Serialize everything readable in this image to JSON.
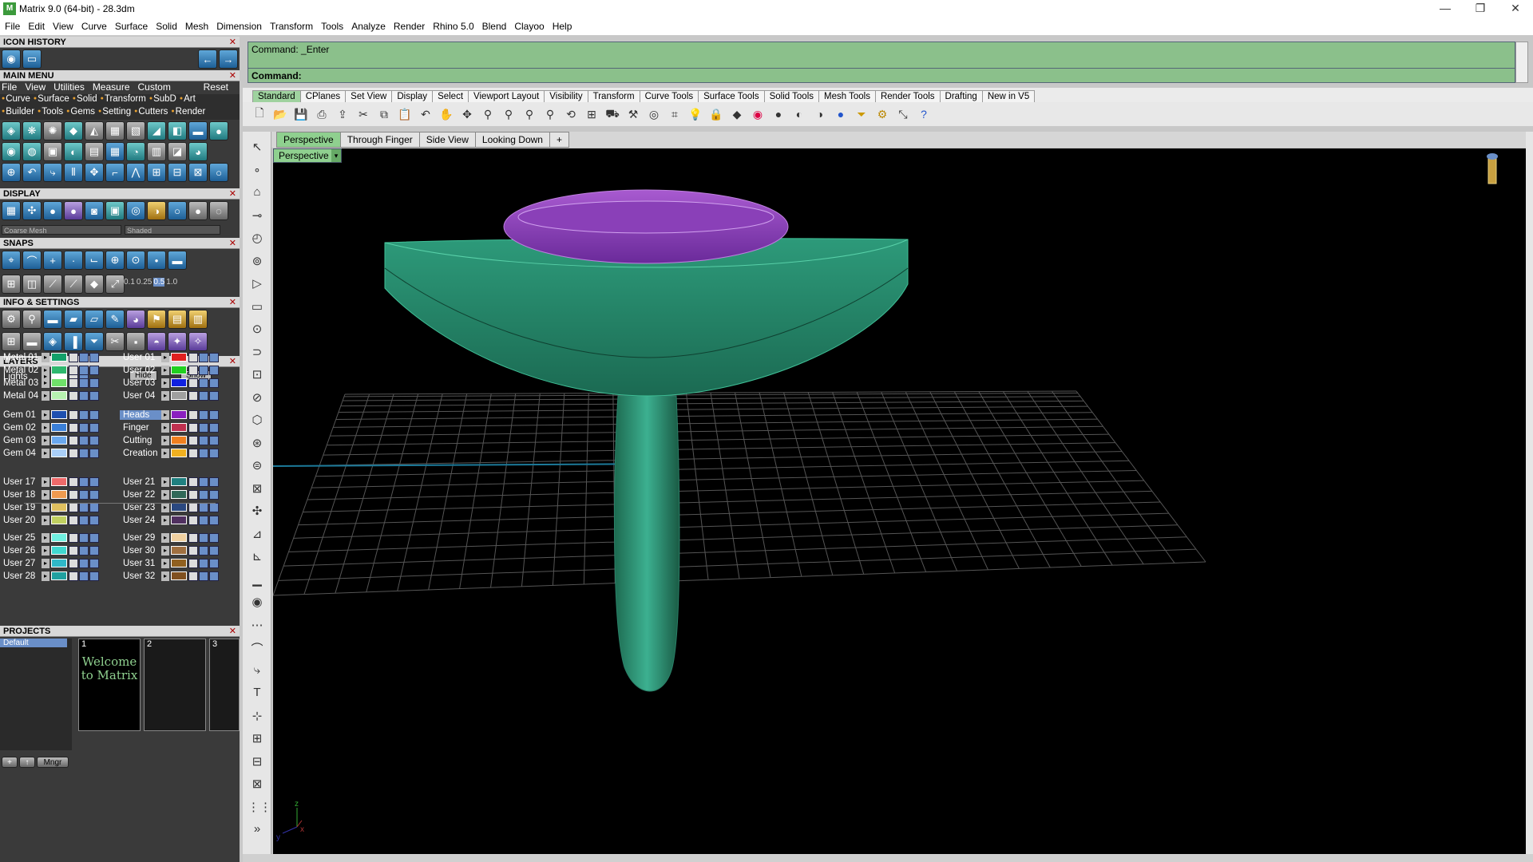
{
  "window": {
    "title": "Matrix 9.0 (64-bit) - 28.3dm",
    "minimize": "—",
    "maximize": "❐",
    "close": "✕"
  },
  "menu": [
    "File",
    "Edit",
    "View",
    "Curve",
    "Surface",
    "Solid",
    "Mesh",
    "Dimension",
    "Transform",
    "Tools",
    "Analyze",
    "Render",
    "Rhino 5.0",
    "Blend",
    "Clayoo",
    "Help"
  ],
  "left": {
    "icon_history": "ICON HISTORY",
    "main_menu": "MAIN MENU",
    "main_menu_items": [
      "File",
      "View",
      "Utilities",
      "Measure",
      "Custom"
    ],
    "reset": "Reset",
    "sub1": [
      "Curve",
      "Surface",
      "Solid",
      "Transform",
      "SubD",
      "Art"
    ],
    "sub2": [
      "Builder",
      "Tools",
      "Gems",
      "Setting",
      "Cutters",
      "Render"
    ],
    "display": "DISPLAY",
    "display_mesh": "Coarse Mesh",
    "display_mode": "Shaded",
    "snaps": "SNAPS",
    "snap_vals": [
      "0.1",
      "0.25",
      "0.5",
      "1.0"
    ],
    "info": "INFO & SETTINGS",
    "layers": "LAYERS",
    "lights": "Lights",
    "hide": "Hide",
    "show": "Show",
    "layers_left": [
      {
        "name": "Metal 01",
        "color": "#13a06a"
      },
      {
        "name": "Metal 02",
        "color": "#2eb86e"
      },
      {
        "name": "Metal 03",
        "color": "#6fe06a"
      },
      {
        "name": "Metal 04",
        "color": "#b6f0b0"
      },
      {
        "name": "Gem 01",
        "color": "#1e4fb0"
      },
      {
        "name": "Gem 02",
        "color": "#3a7fd8"
      },
      {
        "name": "Gem 03",
        "color": "#6aa8ee"
      },
      {
        "name": "Gem 04",
        "color": "#aacff8"
      },
      {
        "name": "User 17",
        "color": "#ee6a6a"
      },
      {
        "name": "User 18",
        "color": "#f09a50"
      },
      {
        "name": "User 19",
        "color": "#e0c060"
      },
      {
        "name": "User 20",
        "color": "#c0d060"
      },
      {
        "name": "User 25",
        "color": "#70f0e0"
      },
      {
        "name": "User 26",
        "color": "#40d8d0"
      },
      {
        "name": "User 27",
        "color": "#30b8c8"
      },
      {
        "name": "User 28",
        "color": "#20a0a0"
      }
    ],
    "layers_right": [
      {
        "name": "User 01",
        "color": "#e02020"
      },
      {
        "name": "User 02",
        "color": "#20d020"
      },
      {
        "name": "User 03",
        "color": "#1020e0"
      },
      {
        "name": "User 04",
        "color": "#a0a0a0"
      },
      {
        "name": "Heads",
        "color": "#8a20c0"
      },
      {
        "name": "Finger",
        "color": "#c03050"
      },
      {
        "name": "Cutting",
        "color": "#f08020"
      },
      {
        "name": "Creation",
        "color": "#f0b020"
      },
      {
        "name": "User 21",
        "color": "#208080"
      },
      {
        "name": "User 22",
        "color": "#306858"
      },
      {
        "name": "User 23",
        "color": "#2a4880"
      },
      {
        "name": "User 24",
        "color": "#503060"
      },
      {
        "name": "User 29",
        "color": "#f0d0a0"
      },
      {
        "name": "User 30",
        "color": "#a07040"
      },
      {
        "name": "User 31",
        "color": "#906020"
      },
      {
        "name": "User 32",
        "color": "#805020"
      }
    ],
    "projects": "PROJECTS",
    "project_default": "Default",
    "project_slots": [
      "1",
      "2",
      "3"
    ],
    "welcome": "Welcome to Matrix",
    "mngr": "Mngr"
  },
  "command": {
    "history": "Command: _Enter",
    "prompt": "Command:"
  },
  "toolbar_tabs": [
    "Standard",
    "CPlanes",
    "Set View",
    "Display",
    "Select",
    "Viewport Layout",
    "Visibility",
    "Transform",
    "Curve Tools",
    "Surface Tools",
    "Solid Tools",
    "Mesh Tools",
    "Render Tools",
    "Drafting",
    "New in V5"
  ],
  "viewport_tabs": [
    "Perspective",
    "Through Finger",
    "Side View",
    "Looking Down",
    "+"
  ],
  "viewport": {
    "label": "Perspective",
    "axis_z": "z",
    "axis_x": "x",
    "axis_y": "y"
  }
}
